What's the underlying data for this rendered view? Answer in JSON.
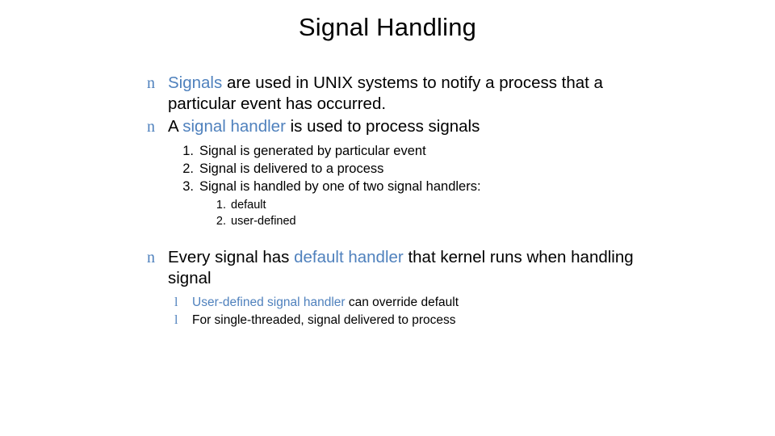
{
  "slide": {
    "title": "Signal Handling",
    "accent_color": "#4f81bd",
    "bullet_marker_level1": "n",
    "bullet_marker_sub": "l",
    "bullets": [
      {
        "lead": "Signals",
        "rest": " are used in UNIX systems to notify a process that a particular event has occurred."
      },
      {
        "pre": "A ",
        "lead": "signal handler",
        "rest": " is used to process signals"
      }
    ],
    "numbered": [
      {
        "num": "1.",
        "text": "Signal is generated by particular event"
      },
      {
        "num": "2.",
        "text": "Signal is delivered to a process"
      },
      {
        "num": "3.",
        "text": "Signal is handled by one of two signal handlers:"
      }
    ],
    "numbered_sub": [
      {
        "num": "1.",
        "text": "default"
      },
      {
        "num": "2.",
        "text": "user-defined"
      }
    ],
    "bullet3": {
      "pre": "Every signal has ",
      "lead": "default handler",
      "rest": " that kernel runs when handling signal"
    },
    "sub_bullets": [
      {
        "lead": "User-defined signal handler",
        "rest": " can override default"
      },
      {
        "lead": "",
        "rest": "For single-threaded, signal delivered to process"
      }
    ]
  }
}
